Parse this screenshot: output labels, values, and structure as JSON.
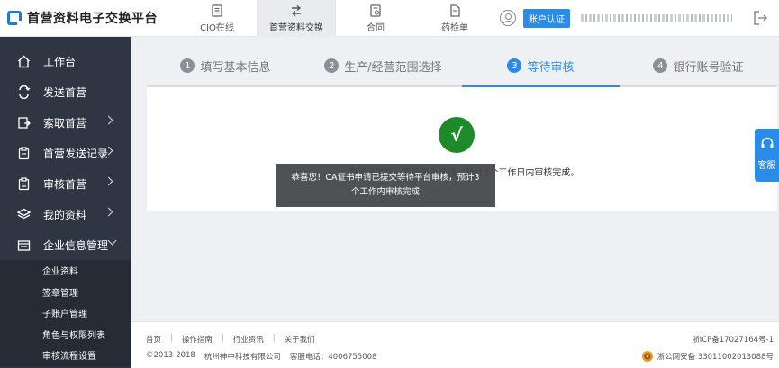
{
  "header": {
    "logo_text": "首营资料电子交换平台",
    "nav": [
      {
        "label": "CIO在线",
        "icon": "document-icon"
      },
      {
        "label": "首营资料交换",
        "icon": "exchange-arrows-icon"
      },
      {
        "label": "合同",
        "icon": "contract-icon"
      },
      {
        "label": "药检单",
        "icon": "report-icon"
      }
    ],
    "active_nav": 1,
    "auth_badge": "账户认证"
  },
  "sidebar": {
    "items": [
      {
        "label": "工作台",
        "icon": "home-icon"
      },
      {
        "label": "发送首营",
        "icon": "send-icon"
      },
      {
        "label": "索取首营",
        "icon": "request-icon"
      },
      {
        "label": "首营发送记录",
        "icon": "record-icon"
      },
      {
        "label": "审核首营",
        "icon": "audit-icon"
      },
      {
        "label": "我的资料",
        "icon": "layers-icon"
      },
      {
        "label": "企业信息管理",
        "icon": "enterprise-icon"
      }
    ],
    "submenu": [
      {
        "label": "企业资料"
      },
      {
        "label": "签章管理"
      },
      {
        "label": "子账户管理"
      },
      {
        "label": "角色与权限列表"
      },
      {
        "label": "审核流程设置"
      }
    ]
  },
  "steps": [
    {
      "num": "1",
      "label": "填写基本信息"
    },
    {
      "num": "2",
      "label": "生产/经营范围选择"
    },
    {
      "num": "3",
      "label": "等待审核"
    },
    {
      "num": "4",
      "label": "银行账号验证"
    }
  ],
  "active_step": 2,
  "panel": {
    "check_glyph": "√",
    "message": "申请已提交，等待平台审核，预计3个工作日内审核完成。"
  },
  "toast": {
    "line1": "恭喜您！CA证书申请已提交等待平台审核，预计3",
    "line2": "个工作内审核完成"
  },
  "service": {
    "label": "客服"
  },
  "footer": {
    "links": [
      "首页",
      "操作指南",
      "行业资讯",
      "关于我们"
    ],
    "copyright": "©2013-2018",
    "company": "杭州神中科技有限公司",
    "phone": "客服电话：4006755008",
    "icp": "浙ICP备17027164号-1",
    "police": "浙公网安备 33011002013088号"
  },
  "colors": {
    "accent": "#2b8ce8",
    "sidebar_bg": "#2f3542",
    "success": "#1f8a2a"
  }
}
